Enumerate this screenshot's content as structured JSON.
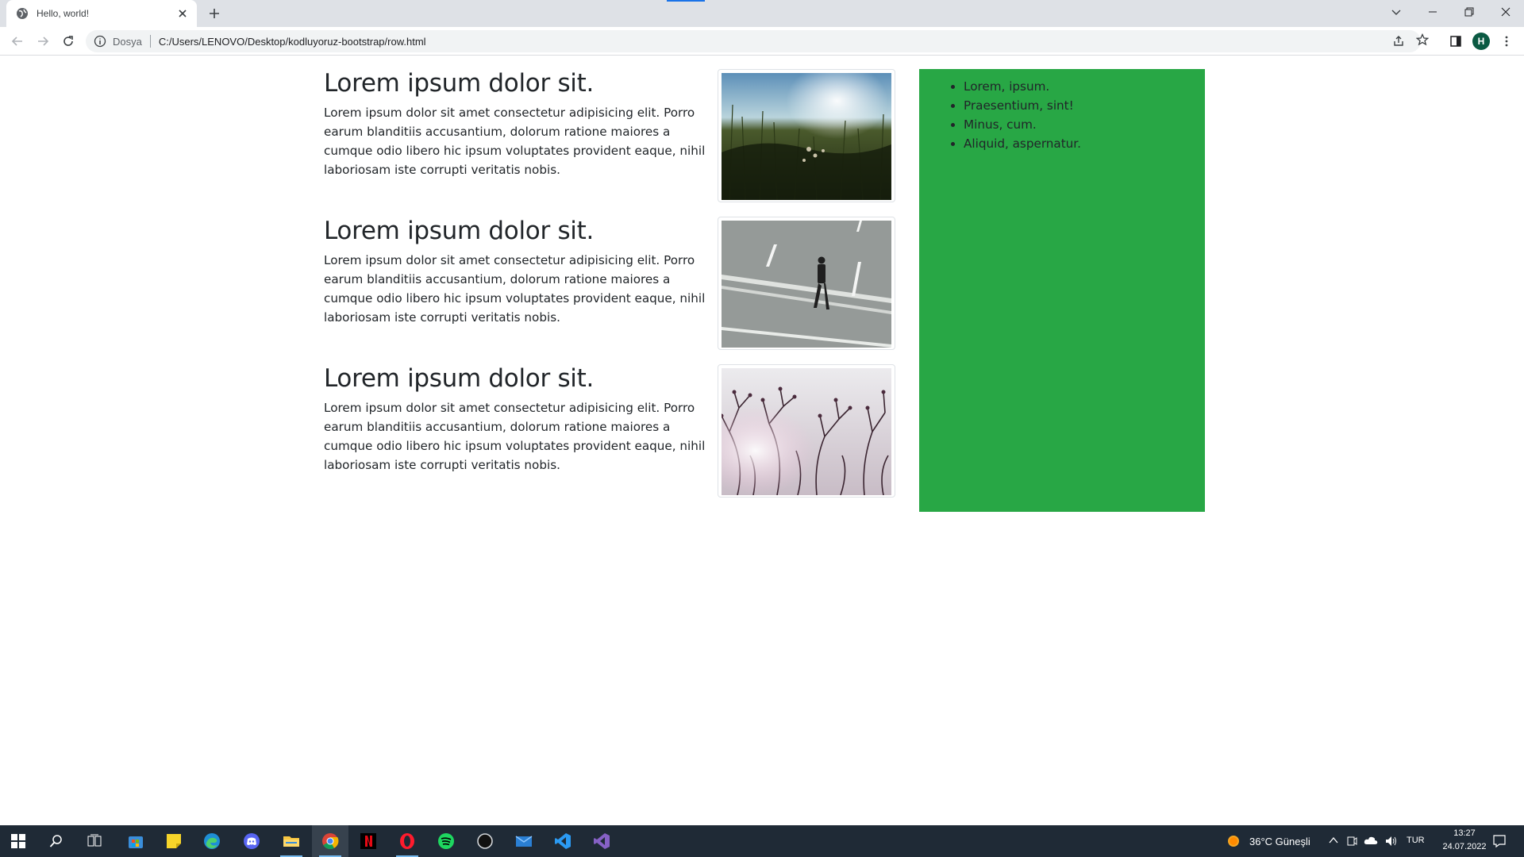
{
  "browser": {
    "tab_title": "Hello, world!",
    "scheme_label": "Dosya",
    "url": "C:/Users/LENOVO/Desktop/kodluyoruz-bootstrap/row.html",
    "profile_initial": "H"
  },
  "media_items": [
    {
      "heading": "Lorem ipsum dolor sit.",
      "text": "Lorem ipsum dolor sit amet consectetur adipisicing elit. Porro earum blanditiis accusantium, dolorum ratione maiores a cumque odio libero hic ipsum voluptates provident eaque, nihil laboriosam iste corrupti veritatis nobis.",
      "image": "grass-field-photo"
    },
    {
      "heading": "Lorem ipsum dolor sit.",
      "text": "Lorem ipsum dolor sit amet consectetur adipisicing elit. Porro earum blanditiis accusantium, dolorum ratione maiores a cumque odio libero hic ipsum voluptates provident eaque, nihil laboriosam iste corrupti veritatis nobis.",
      "image": "man-walking-road-photo"
    },
    {
      "heading": "Lorem ipsum dolor sit.",
      "text": "Lorem ipsum dolor sit amet consectetur adipisicing elit. Porro earum blanditiis accusantium, dolorum ratione maiores a cumque odio libero hic ipsum voluptates provident eaque, nihil laboriosam iste corrupti veritatis nobis.",
      "image": "tree-branches-photo"
    }
  ],
  "sidebar": {
    "background": "#28a745",
    "items": [
      "Lorem, ipsum.",
      "Praesentium, sint!",
      "Minus, cum.",
      "Aliquid, aspernatur."
    ]
  },
  "taskbar": {
    "apps": [
      "windows-start",
      "search",
      "task-view",
      "microsoft-store",
      "sticky-notes",
      "edge",
      "discord",
      "file-explorer",
      "chrome",
      "netflix",
      "opera",
      "spotify",
      "app-circle",
      "mail",
      "vscode",
      "visual-studio"
    ],
    "weather": "36°C  Güneşli",
    "language": "TUR",
    "time": "13:27",
    "date": "24.07.2022"
  }
}
